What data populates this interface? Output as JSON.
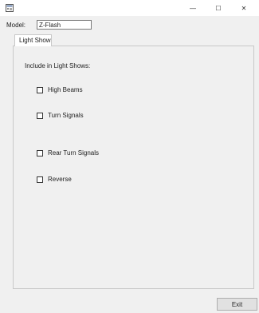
{
  "window": {
    "minimize_glyph": "—",
    "maximize_glyph": "☐",
    "close_glyph": "✕",
    "icon": "app-window-icon"
  },
  "form": {
    "model_label": "Model:",
    "model_value": "Z-Flash"
  },
  "tabs": [
    {
      "label": "Light Show",
      "selected": true
    }
  ],
  "light_show": {
    "group_label": "Include in Light Shows:",
    "options": [
      {
        "label": "High Beams",
        "checked": false
      },
      {
        "label": "Turn Signals",
        "checked": false
      },
      {
        "label": "Rear Turn Signals",
        "checked": false
      },
      {
        "label": "Reverse",
        "checked": false
      }
    ]
  },
  "footer": {
    "exit_label": "Exit"
  }
}
